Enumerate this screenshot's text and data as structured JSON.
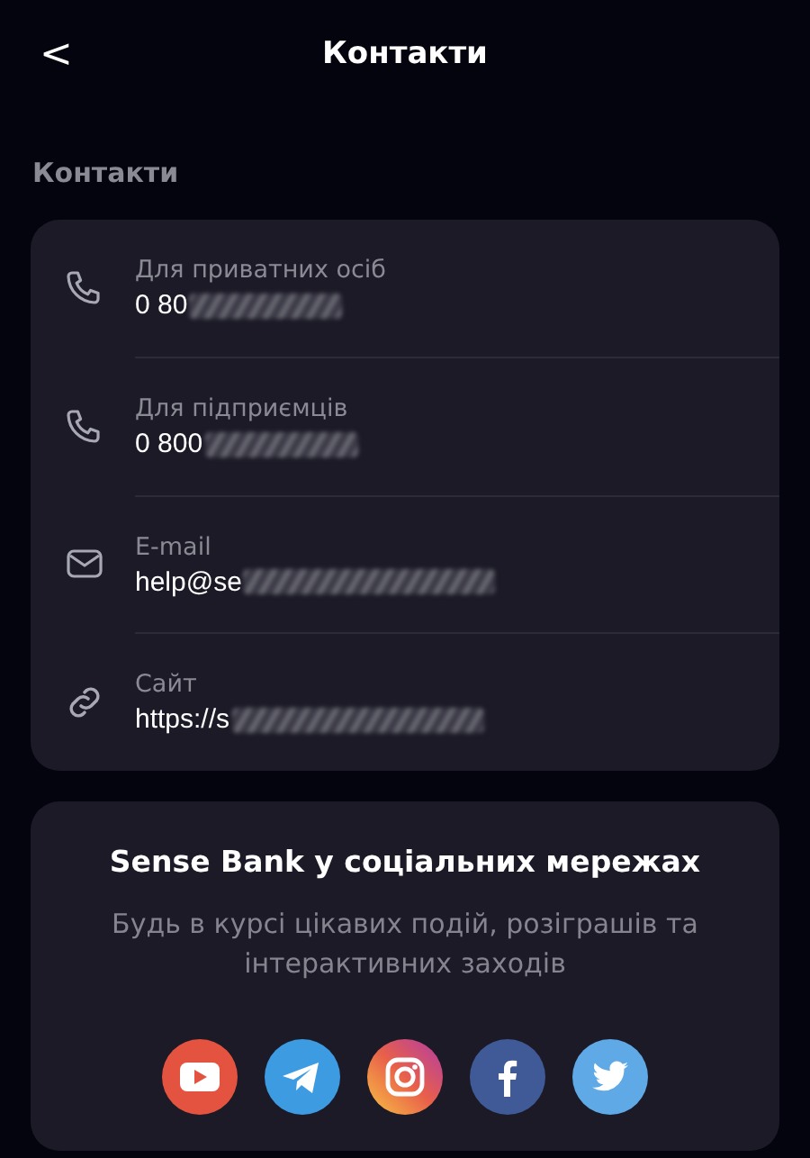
{
  "header": {
    "back": "<",
    "title": "Контакти"
  },
  "section_title": "Контакти",
  "contacts": [
    {
      "kind": "phone",
      "label": "Для приватних осіб",
      "value": "0 80"
    },
    {
      "kind": "phone",
      "label": "Для підприємців",
      "value": "0 800"
    },
    {
      "kind": "email",
      "label": "E-mail",
      "value": "help@se"
    },
    {
      "kind": "link",
      "label": "Сайт",
      "value": "https://s"
    }
  ],
  "social": {
    "title": "Sense Bank у соціальних мережах",
    "text": "Будь в курсі цікавих подій, розіграшів та інтерактивних заходів",
    "networks": [
      {
        "kind": "youtube"
      },
      {
        "kind": "telegram"
      },
      {
        "kind": "instagram"
      },
      {
        "kind": "facebook"
      },
      {
        "kind": "twitter"
      }
    ]
  }
}
